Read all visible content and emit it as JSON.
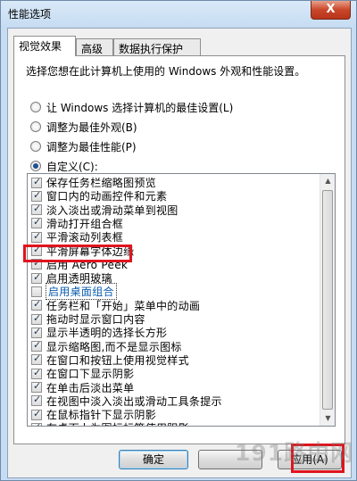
{
  "window": {
    "title": "性能选项",
    "close_label": "X"
  },
  "tabs": [
    {
      "label": "视觉效果"
    },
    {
      "label": "高级"
    },
    {
      "label": "数据执行保护"
    }
  ],
  "description": "选择您想在此计算机上使用的 Windows 外观和性能设置。",
  "radios": [
    {
      "label": "让 Windows 选择计算机的最佳设置(L)",
      "checked": false
    },
    {
      "label": "调整为最佳外观(B)",
      "checked": false
    },
    {
      "label": "调整为最佳性能(P)",
      "checked": false
    },
    {
      "label": "自定义(C):",
      "checked": true
    }
  ],
  "options": [
    {
      "label": "保存任务栏缩略图预览",
      "checked": true
    },
    {
      "label": "窗口内的动画控件和元素",
      "checked": true
    },
    {
      "label": "淡入淡出或滑动菜单到视图",
      "checked": true
    },
    {
      "label": "滑动打开组合框",
      "checked": true
    },
    {
      "label": "平滑滚动列表框",
      "checked": true
    },
    {
      "label": "平滑屏幕字体边缘",
      "checked": true
    },
    {
      "label": "启用 Aero Peek",
      "checked": true
    },
    {
      "label": "启用透明玻璃",
      "checked": true
    },
    {
      "label": "启用桌面组合",
      "checked": false
    },
    {
      "label": "任务栏和「开始」菜单中的动画",
      "checked": true
    },
    {
      "label": "拖动时显示窗口内容",
      "checked": true
    },
    {
      "label": "显示半透明的选择长方形",
      "checked": true
    },
    {
      "label": "显示缩略图,而不是显示图标",
      "checked": true
    },
    {
      "label": "在窗口和按钮上使用视觉样式",
      "checked": true
    },
    {
      "label": "在窗口下显示阴影",
      "checked": true
    },
    {
      "label": "在单击后淡出菜单",
      "checked": true
    },
    {
      "label": "在视图中淡入淡出或滑动工具条提示",
      "checked": true
    },
    {
      "label": "在鼠标指针下显示阴影",
      "checked": true
    },
    {
      "label": "在桌面上为图标标签使用阴影",
      "checked": true
    }
  ],
  "buttons": {
    "ok": "确定",
    "apply": "应用(A)"
  },
  "watermark": "191路由网",
  "colors": {
    "highlight": "#e0141e",
    "focus_text": "#0b5cad"
  }
}
